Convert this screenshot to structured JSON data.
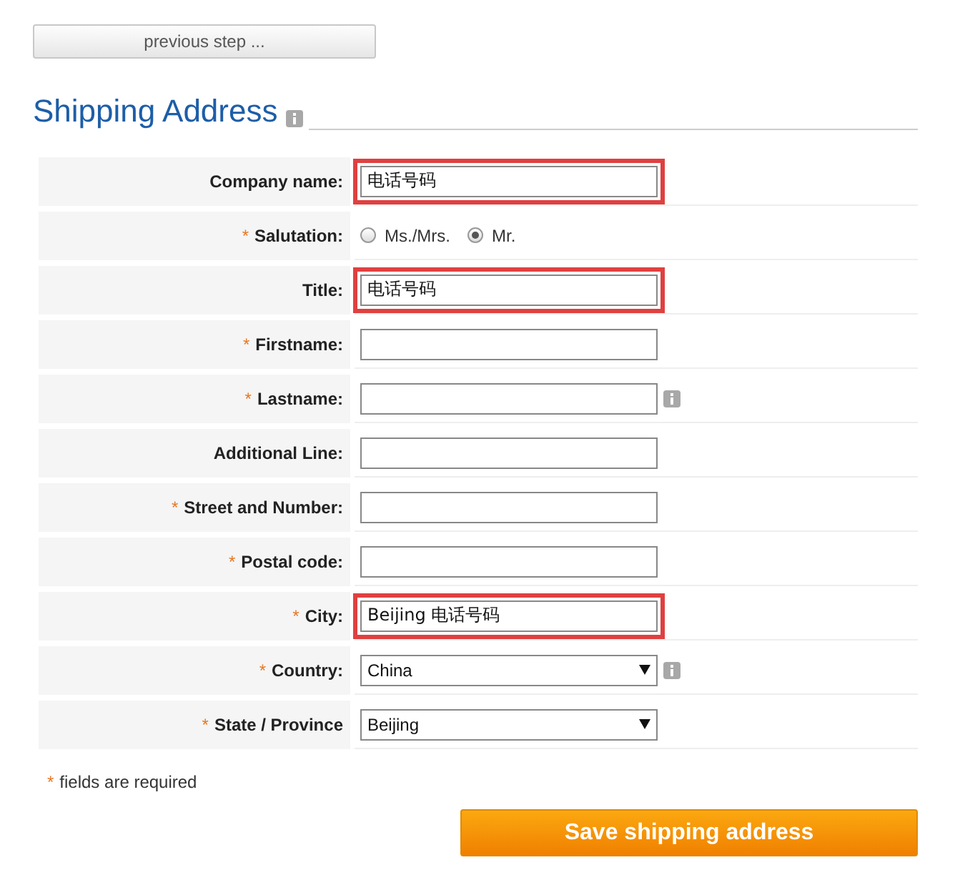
{
  "back_button": {
    "label": "previous step ..."
  },
  "heading": {
    "title": "Shipping Address",
    "info": true
  },
  "rows": [
    {
      "kind": "text",
      "label": "Company name:",
      "value": "电话号码",
      "highlighted": true
    },
    {
      "kind": "radio",
      "mark": "*",
      "label": "Salutation:",
      "options": [
        {
          "label": "Ms./Mrs.",
          "selected": false
        },
        {
          "label": "Mr.",
          "selected": true
        }
      ]
    },
    {
      "kind": "text",
      "label": "Title:",
      "value": "电话号码",
      "highlighted": true
    },
    {
      "kind": "text",
      "mark": "*",
      "label": "Firstname:"
    },
    {
      "kind": "text",
      "mark": "*",
      "label": "Lastname:",
      "info": true
    },
    {
      "kind": "text",
      "label": "Additional Line:"
    },
    {
      "kind": "text",
      "mark": "*",
      "label": "Street and Number:"
    },
    {
      "kind": "text",
      "mark": "*",
      "label": "Postal code:"
    },
    {
      "kind": "text",
      "mark": "*",
      "label": "City:",
      "value": "Beijing 电话号码",
      "highlighted": true
    },
    {
      "kind": "select",
      "mark": "*",
      "label": "Country:",
      "value": "China",
      "info": true
    },
    {
      "kind": "select",
      "mark": "*",
      "label": "State / Province",
      "value": "Beijing"
    }
  ],
  "footnote": {
    "mark": "*",
    "text": "fields are required"
  },
  "save_button": {
    "label": "Save shipping address"
  }
}
